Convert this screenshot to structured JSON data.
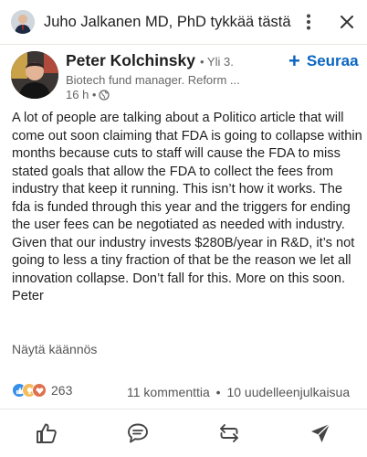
{
  "activity": {
    "actor_text": "Juho Jalkanen MD, PhD tykkää tästä",
    "more_icon": "more-vertical-icon",
    "close_icon": "close-icon"
  },
  "author": {
    "name": "Peter Kolchinsky",
    "degree": "• Yli 3.",
    "headline": "Biotech fund manager. Reform ...",
    "time": "16 h •",
    "visibility_icon": "globe-icon"
  },
  "follow": {
    "label": "Seuraa"
  },
  "post": {
    "paragraphs": [
      "A lot of people are talking about a Politico article that will come out soon claiming that FDA is going to collapse within months because cuts to staff will cause the FDA to miss stated goals that allow the FDA to collect the fees from industry that keep it running. This isn’t how it works. The fda is funded through this year and the triggers for ending the user fees can be negotiated as needed with industry. Given that our industry invests $280B/year in R&D, it’s not going to less a tiny fraction of that be the reason we let all innovation collapse. Don’t fall for this. More on this soon.",
      "Peter"
    ],
    "translate_label": "Näytä käännös"
  },
  "social": {
    "reaction_count": "263",
    "comments": "11 kommenttia",
    "separator": "•",
    "reposts": "10 uudelleenjulkaisua"
  },
  "actions": {
    "like_icon": "thumbs-up-icon",
    "comment_icon": "comment-icon",
    "repost_icon": "repost-icon",
    "send_icon": "send-icon"
  },
  "colors": {
    "accent": "#0a66c2",
    "text": "#1f1f1f",
    "muted": "#666666"
  }
}
